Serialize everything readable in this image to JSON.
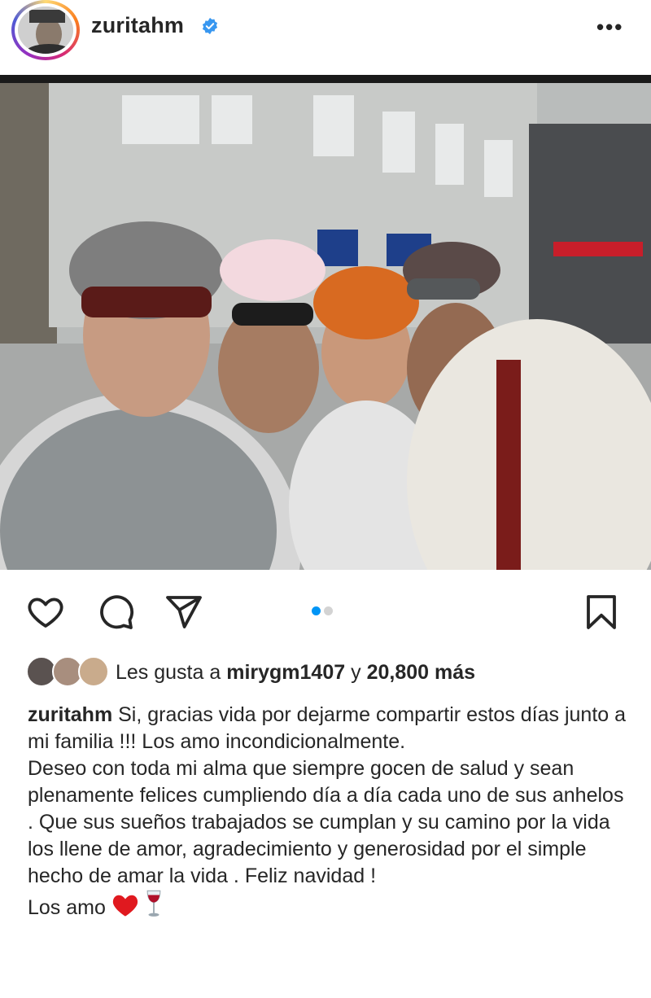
{
  "post": {
    "username": "zuritahm",
    "more_icon": "more-horizontal-icon",
    "more_label": "•••",
    "verified_icon": "verified-badge-icon"
  },
  "actions": {
    "like_icon": "heart-icon",
    "comment_icon": "comment-icon",
    "share_icon": "send-icon",
    "save_icon": "bookmark-icon",
    "carousel_total": 2,
    "carousel_active": 1
  },
  "likes": {
    "prefix": "Les gusta a ",
    "user": "mirygm1407",
    "middle": " y ",
    "count": "20,800 más"
  },
  "caption": {
    "username": "zuritahm",
    "line1": " Si, gracias vida por dejarme compartir estos días junto a mi familia !!! Los amo incondicionalmente.",
    "paragraph2": "Deseo con toda mi alma que siempre gocen de salud y sean plenamente felices cumpliendo día a día cada uno de sus anhelos .  Que sus sueños trabajados se cumplan y su camino por la vida los llene de amor, agradecimiento y generosidad por el simple hecho de amar la vida . Feliz navidad !",
    "closing": "Los amo "
  },
  "colors": {
    "accent_blue": "#0095f6",
    "text": "#262626",
    "verified": "#3897f0"
  }
}
